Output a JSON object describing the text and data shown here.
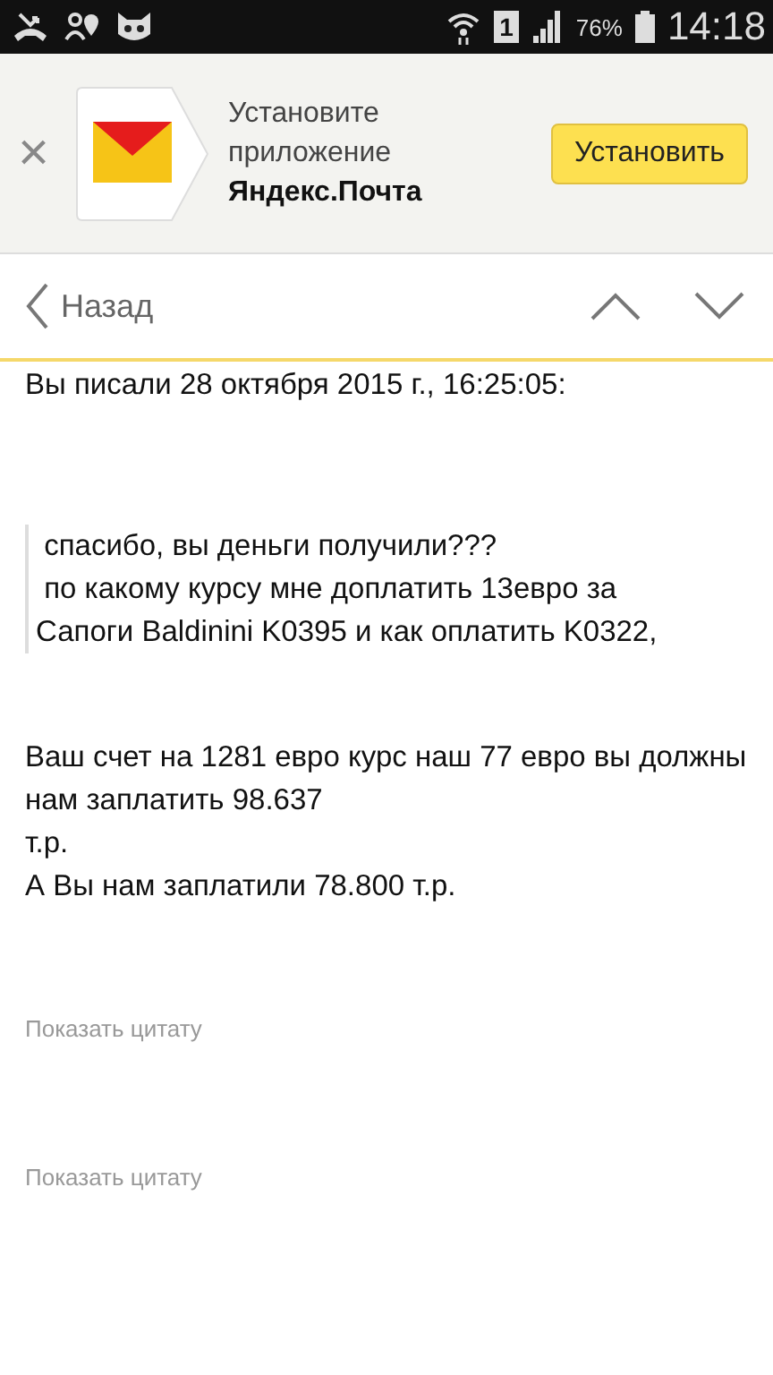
{
  "status_bar": {
    "sim": "1",
    "battery": "76%",
    "time": "14:18"
  },
  "banner": {
    "close": "×",
    "lines": [
      "Установите",
      "приложение"
    ],
    "app_name": "Яндекс.Почта",
    "install_button": "Установить"
  },
  "nav": {
    "back": "Назад"
  },
  "message": {
    "header": "Вы писали 28 октября 2015 г., 16:25:05:",
    "quote": [
      " спасибо, вы деньги получили???",
      " по какому курсу мне доплатить 13евро за",
      "Сапоги Baldinini K0395 и как оплатить K0322,"
    ],
    "body": [
      "Ваш счет на 1281 евро курс наш 77 евро вы должны нам заплатить 98.637",
      "т.р.",
      "А Вы нам заплатили 78.800 т.р."
    ],
    "show_quote_links": [
      "Показать цитату",
      "Показать цитату"
    ]
  }
}
